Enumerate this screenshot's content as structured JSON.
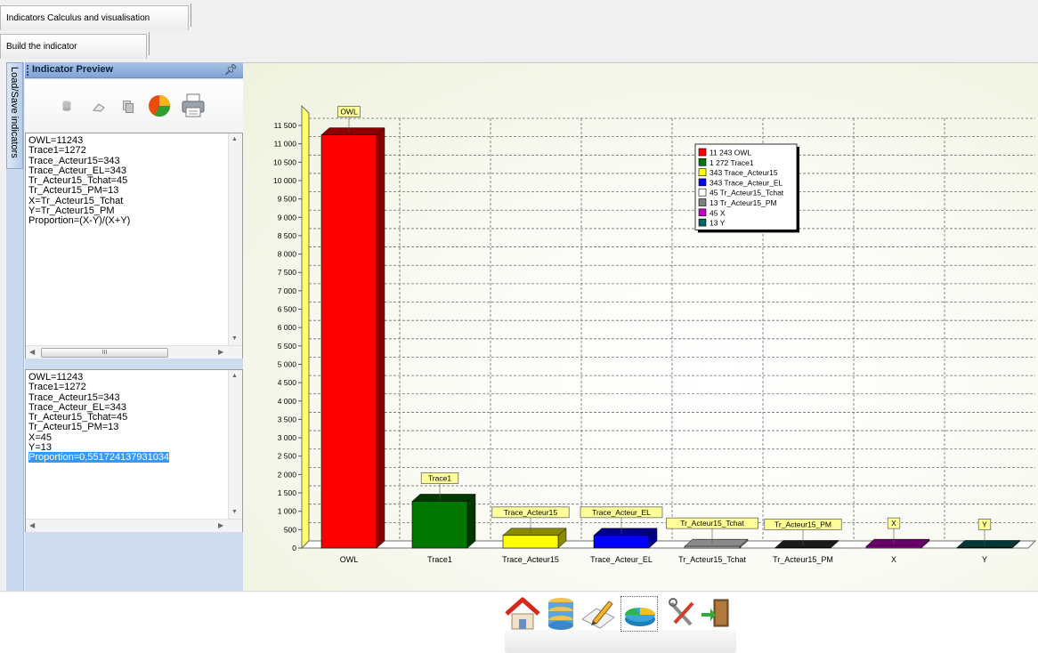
{
  "tabs": {
    "calc_label": "Indicators Calculus and visualisation",
    "build_label": "Build the indicator"
  },
  "side_strip": {
    "label": "Load/Save indicators"
  },
  "panel": {
    "title": "Indicator Preview",
    "toolbar_icons": [
      "database-icon",
      "eraser-icon",
      "copy-icon",
      "pie-chart-icon",
      "printer-icon"
    ],
    "formula_lines": [
      "OWL=11243",
      "Trace1=1272",
      "Trace_Acteur15=343",
      "Trace_Acteur_EL=343",
      "Tr_Acteur15_Tchat=45",
      "Tr_Acteur15_PM=13",
      "X=Tr_Acteur15_Tchat",
      "Y=Tr_Acteur15_PM",
      "Proportion=(X-Y)/(X+Y)"
    ],
    "result_lines": [
      "OWL=11243",
      "Trace1=1272",
      "Trace_Acteur15=343",
      "Trace_Acteur_EL=343",
      "Tr_Acteur15_Tchat=45",
      "Tr_Acteur15_PM=13",
      "X=45",
      "Y=13",
      "Proportion=0,551724137931034"
    ],
    "scroll_thumb_label": "III"
  },
  "chart_data": {
    "type": "bar",
    "categories": [
      "OWL",
      "Trace1",
      "Trace_Acteur15",
      "Trace_Acteur_EL",
      "Tr_Acteur15_Tchat",
      "Tr_Acteur15_PM",
      "X",
      "Y"
    ],
    "values": [
      11243,
      1272,
      343,
      343,
      45,
      13,
      45,
      13
    ],
    "bar_labels": [
      "OWL",
      "Trace1",
      "Trace_Acteur15",
      "Trace_Acteur_EL",
      "Tr_Acteur15_Tchat",
      "Tr_Acteur15_PM",
      "X",
      "Y"
    ],
    "colors": [
      "#ff0000",
      "#007800",
      "#ffff00",
      "#0000ff",
      "#c8c8c8",
      "#404040",
      "#c000c0",
      "#006464"
    ],
    "side_colors": [
      "#8a0000",
      "#003800",
      "#8a8a00",
      "#00008a",
      "#8a8a8a",
      "#1a1a1a",
      "#6a006a",
      "#003838"
    ],
    "ylim": [
      0,
      11500
    ],
    "yticks": [
      "0",
      "500",
      "1 000",
      "1 500",
      "2 000",
      "2 500",
      "3 000",
      "3 500",
      "4 000",
      "4 500",
      "5 000",
      "5 500",
      "6 000",
      "6 500",
      "7 000",
      "7 500",
      "8 000",
      "8 500",
      "9 000",
      "9 500",
      "10 000",
      "10 500",
      "11 000",
      "11 500"
    ],
    "ytick_values": [
      0,
      500,
      1000,
      1500,
      2000,
      2500,
      3000,
      3500,
      4000,
      4500,
      5000,
      5500,
      6000,
      6500,
      7000,
      7500,
      8000,
      8500,
      9000,
      9500,
      10000,
      10500,
      11000,
      11500
    ],
    "legend": [
      "11 243 OWL",
      "1 272 Trace1",
      "343 Trace_Acteur15",
      "343 Trace_Acteur_EL",
      "45 Tr_Acteur15_Tchat",
      "13 Tr_Acteur15_PM",
      "45 X",
      "13 Y"
    ],
    "legend_colors": [
      "#ff0000",
      "#007800",
      "#ffff00",
      "#0000ff",
      "#ffffff",
      "#808080",
      "#c000c0",
      "#006464"
    ],
    "legend_position": "top-right",
    "grid": true
  },
  "dock": {
    "icons": [
      "home-icon",
      "database-icon",
      "edit-icon",
      "pie-chart-icon",
      "tools-icon",
      "exit-icon"
    ],
    "selected": "pie-chart-icon"
  }
}
